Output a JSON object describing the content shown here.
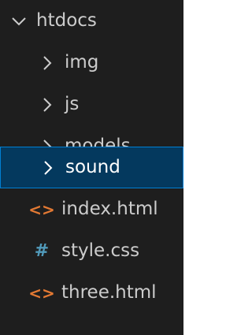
{
  "explorer": {
    "root": {
      "label": "htdocs",
      "icon": "chevron-down-icon"
    },
    "folders": [
      {
        "label": "img",
        "icon": "chevron-right-icon"
      },
      {
        "label": "js",
        "icon": "chevron-right-icon"
      },
      {
        "label": "models",
        "icon": "chevron-right-icon"
      },
      {
        "label": "sound",
        "icon": "chevron-right-icon",
        "selected": true
      }
    ],
    "files": [
      {
        "label": "index.html",
        "icon": "html-file-icon",
        "glyph": "<>",
        "color": "#e37933"
      },
      {
        "label": "style.css",
        "icon": "css-file-icon",
        "glyph": "#",
        "color": "#519aba"
      },
      {
        "label": "three.html",
        "icon": "html-file-icon",
        "glyph": "<>",
        "color": "#e37933"
      }
    ]
  },
  "colors": {
    "background": "#1e1e1e",
    "text": "#cccccc",
    "selection_bg": "#04395e",
    "selection_border": "#007fd4"
  }
}
